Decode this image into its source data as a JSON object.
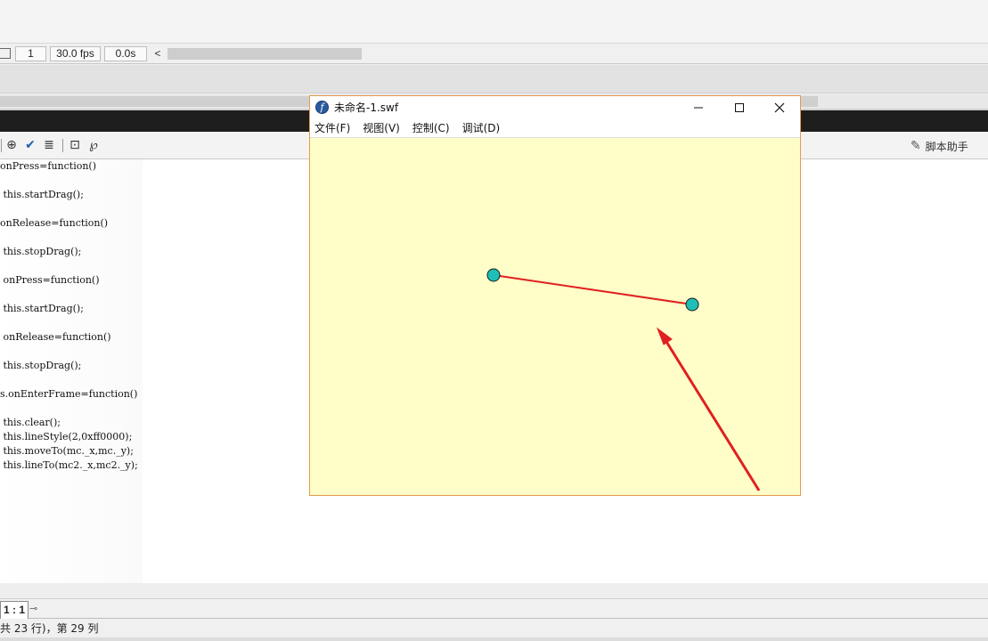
{
  "timeline": {
    "frame": "1",
    "fps": "30.0 fps",
    "time": "0.0s",
    "scroll_left_glyph": "<"
  },
  "actions_panel": {
    "script_assist_label": "脚本助手",
    "code_lines": [
      "onPress=function()",
      "",
      " this.startDrag();",
      "",
      "onRelease=function()",
      "",
      " this.stopDrag();",
      "",
      " onPress=function()",
      "",
      " this.startDrag();",
      "",
      " onRelease=function()",
      "",
      " this.stopDrag();",
      "",
      "s.onEnterFrame=function()",
      "",
      " this.clear();",
      " this.lineStyle(2,0xff0000);",
      " this.moveTo(mc._x,mc._y);",
      " this.lineTo(mc2._x,mc2._y);"
    ]
  },
  "script_tab": {
    "label": "1 : 1"
  },
  "status_bar": {
    "text": "共 23 行)，第 29 列"
  },
  "swf_window": {
    "title": "未命名-1.swf",
    "menu": [
      "文件(F)",
      "视图(V)",
      "控制(C)",
      "调试(D)"
    ],
    "stage_color": "#fffdc8",
    "dot_color": "#1fbfb8",
    "line_color": "#e02020",
    "arrow_color": "#e02020",
    "border_color": "#e59a4d"
  },
  "icons": {
    "toolbar": [
      "target-icon",
      "check-syntax-icon",
      "auto-format-icon",
      "debug-options-icon",
      "collapse-icon"
    ],
    "window": [
      "minimize-icon",
      "maximize-icon",
      "close-icon"
    ]
  }
}
